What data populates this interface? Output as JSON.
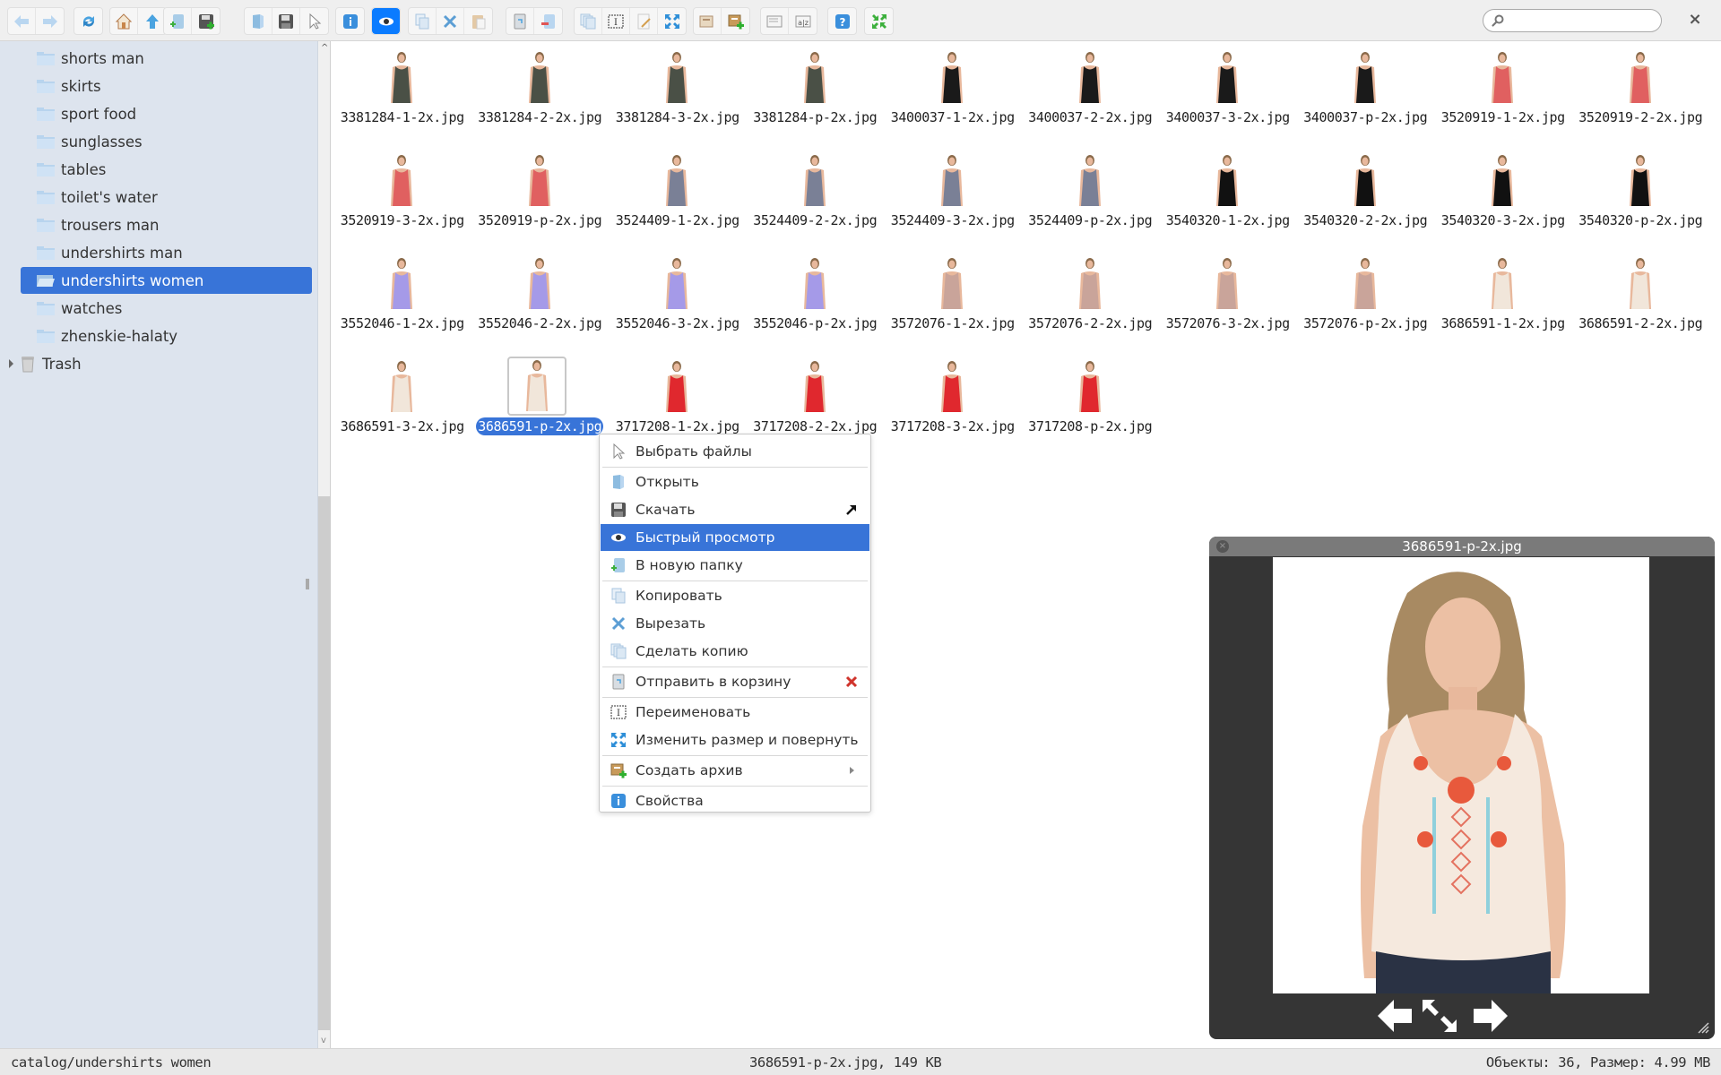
{
  "toolbar": {
    "groups": [
      [
        {
          "name": "back-icon",
          "label": "Back"
        },
        {
          "name": "forward-icon",
          "label": "Forward"
        }
      ],
      [
        {
          "name": "reload-icon",
          "label": "Reload"
        }
      ],
      [
        {
          "name": "home-icon",
          "label": "Home"
        },
        {
          "name": "up-icon",
          "label": "Up"
        }
      ],
      [
        {
          "name": "new-folder-icon",
          "label": "New folder"
        },
        {
          "name": "upload-icon",
          "label": "Upload"
        }
      ],
      [
        {
          "name": "open-icon",
          "label": "Open"
        },
        {
          "name": "download-icon",
          "label": "Download"
        },
        {
          "name": "select-icon",
          "label": "Select"
        }
      ],
      [
        {
          "name": "info-icon",
          "label": "Info"
        }
      ],
      [
        {
          "name": "quicklook-icon",
          "label": "Quick look",
          "active": true
        }
      ],
      [
        {
          "name": "copy-icon",
          "label": "Copy"
        },
        {
          "name": "cut-icon",
          "label": "Cut"
        },
        {
          "name": "paste-icon",
          "label": "Paste"
        }
      ],
      [
        {
          "name": "trash-icon",
          "label": "Trash"
        },
        {
          "name": "remove-icon",
          "label": "Remove"
        }
      ],
      [
        {
          "name": "duplicate-icon",
          "label": "Duplicate"
        },
        {
          "name": "rename-icon",
          "label": "Rename"
        },
        {
          "name": "edit-icon",
          "label": "Edit"
        },
        {
          "name": "resize-icon",
          "label": "Resize"
        }
      ],
      [
        {
          "name": "extract-icon",
          "label": "Extract"
        },
        {
          "name": "archive-icon",
          "label": "Archive"
        }
      ],
      [
        {
          "name": "view-icon",
          "label": "View"
        },
        {
          "name": "sort-icon",
          "label": "Sort"
        }
      ],
      [
        {
          "name": "help-icon",
          "label": "Help"
        }
      ],
      [
        {
          "name": "fullscreen-icon",
          "label": "Fullscreen"
        }
      ]
    ],
    "search_placeholder": "",
    "close_label": "×"
  },
  "sidebar": {
    "items": [
      {
        "label": "shorts man"
      },
      {
        "label": "skirts"
      },
      {
        "label": "sport food"
      },
      {
        "label": "sunglasses"
      },
      {
        "label": "tables"
      },
      {
        "label": "toilet's water"
      },
      {
        "label": "trousers man"
      },
      {
        "label": "undershirts man"
      },
      {
        "label": "undershirts women",
        "selected": true
      },
      {
        "label": "watches"
      },
      {
        "label": "zhenskie-halaty"
      }
    ],
    "trash_label": "Trash"
  },
  "files": [
    {
      "name": "3381284-1-2x.jpg",
      "color": "#4a5046"
    },
    {
      "name": "3381284-2-2x.jpg",
      "color": "#4a5046"
    },
    {
      "name": "3381284-3-2x.jpg",
      "color": "#4a5046"
    },
    {
      "name": "3381284-p-2x.jpg",
      "color": "#4a5046"
    },
    {
      "name": "3400037-1-2x.jpg",
      "color": "#1a1a1a"
    },
    {
      "name": "3400037-2-2x.jpg",
      "color": "#1a1a1a"
    },
    {
      "name": "3400037-3-2x.jpg",
      "color": "#1a1a1a"
    },
    {
      "name": "3400037-p-2x.jpg",
      "color": "#1a1a1a"
    },
    {
      "name": "3520919-1-2x.jpg",
      "color": "#e06060"
    },
    {
      "name": "3520919-2-2x.jpg",
      "color": "#e06060"
    },
    {
      "name": "3520919-3-2x.jpg",
      "color": "#e06060"
    },
    {
      "name": "3520919-p-2x.jpg",
      "color": "#e06060"
    },
    {
      "name": "3524409-1-2x.jpg",
      "color": "#7a8096"
    },
    {
      "name": "3524409-2-2x.jpg",
      "color": "#7a8096"
    },
    {
      "name": "3524409-3-2x.jpg",
      "color": "#7a8096"
    },
    {
      "name": "3524409-p-2x.jpg",
      "color": "#7a8096"
    },
    {
      "name": "3540320-1-2x.jpg",
      "color": "#111111"
    },
    {
      "name": "3540320-2-2x.jpg",
      "color": "#111111"
    },
    {
      "name": "3540320-3-2x.jpg",
      "color": "#111111"
    },
    {
      "name": "3540320-p-2x.jpg",
      "color": "#111111"
    },
    {
      "name": "3552046-1-2x.jpg",
      "color": "#a59ae8"
    },
    {
      "name": "3552046-2-2x.jpg",
      "color": "#a59ae8"
    },
    {
      "name": "3552046-3-2x.jpg",
      "color": "#a59ae8"
    },
    {
      "name": "3552046-p-2x.jpg",
      "color": "#a59ae8"
    },
    {
      "name": "3572076-1-2x.jpg",
      "color": "#c9a49a"
    },
    {
      "name": "3572076-2-2x.jpg",
      "color": "#c9a49a"
    },
    {
      "name": "3572076-3-2x.jpg",
      "color": "#c9a49a"
    },
    {
      "name": "3572076-p-2x.jpg",
      "color": "#c9a49a"
    },
    {
      "name": "3686591-1-2x.jpg",
      "color": "#f1e6da"
    },
    {
      "name": "3686591-2-2x.jpg",
      "color": "#f1e6da"
    },
    {
      "name": "3686591-3-2x.jpg",
      "color": "#f1e6da"
    },
    {
      "name": "3686591-p-2x.jpg",
      "color": "#f1e6da",
      "selected": true
    },
    {
      "name": "3717208-1-2x.jpg",
      "color": "#e0282e"
    },
    {
      "name": "3717208-2-2x.jpg",
      "color": "#e0282e"
    },
    {
      "name": "3717208-3-2x.jpg",
      "color": "#e0282e"
    },
    {
      "name": "3717208-p-2x.jpg",
      "color": "#e0282e"
    }
  ],
  "context_menu": {
    "items": [
      {
        "label": "Выбрать файлы",
        "icon": "select-icon"
      },
      {
        "sep": true
      },
      {
        "label": "Открыть",
        "icon": "open-icon"
      },
      {
        "label": "Скачать",
        "icon": "download-icon",
        "trail": "external-arrow-icon"
      },
      {
        "label": "Быстрый просмотр",
        "icon": "eye-icon",
        "highlighted": true
      },
      {
        "label": "В новую папку",
        "icon": "new-folder-icon"
      },
      {
        "sep": true
      },
      {
        "label": "Копировать",
        "icon": "copy-icon"
      },
      {
        "label": "Вырезать",
        "icon": "cut-icon"
      },
      {
        "label": "Сделать копию",
        "icon": "duplicate-icon"
      },
      {
        "sep": true
      },
      {
        "label": "Отправить в корзину",
        "icon": "trash-icon",
        "trail": "delete-x-icon"
      },
      {
        "sep": true
      },
      {
        "label": "Переименовать",
        "icon": "rename-icon"
      },
      {
        "label": "Изменить размер и повернуть",
        "icon": "resize-icon"
      },
      {
        "sep": true
      },
      {
        "label": "Создать архив",
        "icon": "archive-icon",
        "trail": "submenu-arrow-icon"
      },
      {
        "sep": true
      },
      {
        "label": "Свойства",
        "icon": "info-icon"
      }
    ]
  },
  "quicklook": {
    "title": "3686591-p-2x.jpg",
    "close_label": "×"
  },
  "status": {
    "path": "catalog/undershirts women",
    "selection": "3686591-p-2x.jpg, 149 KB",
    "stats": "Объекты: 36, Размер: 4.99 MB"
  },
  "colors": {
    "accent": "#3874d8",
    "toolbar_active": "#0a7bff",
    "sidebar_bg": "#dde4ee",
    "quicklook_bg": "#353535"
  }
}
